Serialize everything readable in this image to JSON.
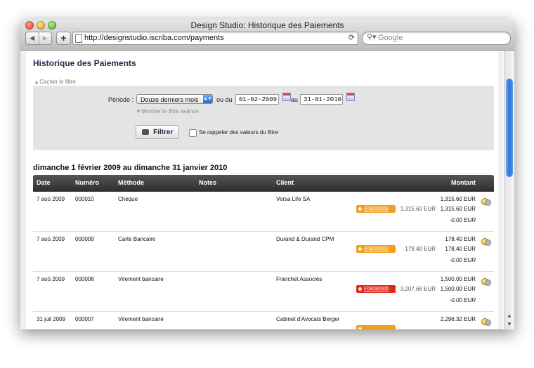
{
  "window": {
    "title": "Design Studio: Historique des Paiements",
    "url": "http://designstudio.iscriba.com/payments",
    "search_placeholder": "Google",
    "back_icon": "◀",
    "forward_icon": "▶",
    "add_icon": "+",
    "reload_icon": "⟳",
    "search_icon": "⚲▾"
  },
  "page": {
    "title": "Historique des Paiements",
    "hide_filter": "Cacher le filtre"
  },
  "filter": {
    "period_label": "Période :",
    "period_value": "Douze derniers mois",
    "from_label": "ou du",
    "from_date": "01-02-2009",
    "to_label": "au",
    "to_date": "31-01-2010",
    "advanced": "Montrer le filtre avancé",
    "filter_button": "Filtrer",
    "remember_label": "Se rappeler des valeurs du filtre"
  },
  "range_title": "dimanche 1 février 2009 au dimanche 31 janvier 2010",
  "table": {
    "headers": {
      "date": "Date",
      "numero": "Numéro",
      "methode": "Méthode",
      "notes": "Notes",
      "client": "Client",
      "montant": "Montant"
    },
    "rows": [
      {
        "date": "7 aoû 2009",
        "numero": "000010",
        "methode": "Chèque",
        "notes": "",
        "client": "Versa Life SA",
        "montant": "1,315.60 EUR",
        "invoice": "F09060008",
        "invoice_status": "orange",
        "invoice_amount": "1,315.60 EUR",
        "applied": "1,315.60 EUR",
        "balance": "-0.00 EUR"
      },
      {
        "date": "7 aoû 2009",
        "numero": "000009",
        "methode": "Carte Bancaire",
        "notes": "",
        "client": "Durand & Durand CPM",
        "montant": "178.40 EUR",
        "invoice": "F09080007",
        "invoice_status": "orange",
        "invoice_amount": "179.40 EUR",
        "applied": "178.40 EUR",
        "balance": "-0.00 EUR"
      },
      {
        "date": "7 aoû 2009",
        "numero": "000008",
        "methode": "Virement bancaire",
        "notes": "",
        "client": "Franchet Associés",
        "montant": "1,500.00 EUR",
        "invoice": "F09080006",
        "invoice_status": "red",
        "invoice_amount": "3,207.68 EUR",
        "applied": "1,500.00 EUR",
        "balance": "-0.00 EUR"
      },
      {
        "date": "31 juil 2009",
        "numero": "000007",
        "methode": "Virement bancaire",
        "notes": "",
        "client": "Cabinet d'Avocats Berger",
        "montant": "2,296.32 EUR",
        "invoice": "",
        "invoice_status": "orange",
        "invoice_amount": "",
        "applied": "",
        "balance": ""
      }
    ]
  },
  "colors": {
    "badge_orange": "#f0a020",
    "badge_red": "#e02a1a",
    "header_dark": "#3a3a3a",
    "title_navy": "#1e2b4a"
  }
}
